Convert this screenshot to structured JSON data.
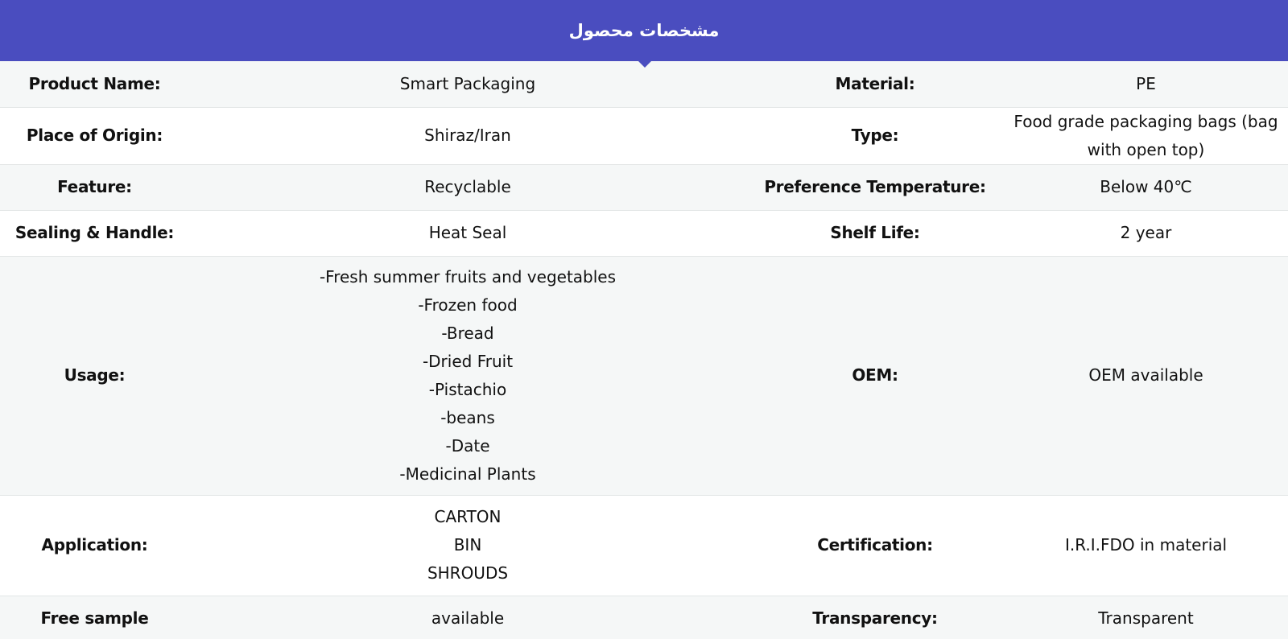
{
  "header": {
    "title": "مشخصات محصول"
  },
  "colors": {
    "header_bg": "#4a4dbf",
    "row_alt_bg": "#f5f7f7",
    "divider": "#e3e6e6"
  },
  "rows": [
    {
      "label1": "Product Name:",
      "value1": "Smart Packaging",
      "label2": "Material:",
      "value2": "PE"
    },
    {
      "label1": "Place of Origin:",
      "value1": "Shiraz/Iran",
      "label2": "Type:",
      "value2": "Food grade packaging bags (bag with open top)"
    },
    {
      "label1": "Feature:",
      "value1": "Recyclable",
      "label2": "Preference Temperature:",
      "value2": "Below 40℃"
    },
    {
      "label1": "Sealing & Handle:",
      "value1": "Heat Seal",
      "label2": "Shelf Life:",
      "value2": "2 year"
    },
    {
      "label1": "Usage:",
      "value1_lines": [
        "-Fresh summer fruits and vegetables",
        "-Frozen food",
        "-Bread",
        "-Dried Fruit",
        "-Pistachio",
        "-beans",
        "-Date",
        "-Medicinal Plants"
      ],
      "label2": "OEM:",
      "value2": "OEM available"
    },
    {
      "label1": "Application:",
      "value1_lines": [
        "CARTON",
        "BIN",
        "SHROUDS"
      ],
      "label2": "Certification:",
      "value2": "I.R.I.FDO in material"
    },
    {
      "label1": "Free sample",
      "value1": "available",
      "label2": "Transparency:",
      "value2": "Transparent"
    }
  ]
}
